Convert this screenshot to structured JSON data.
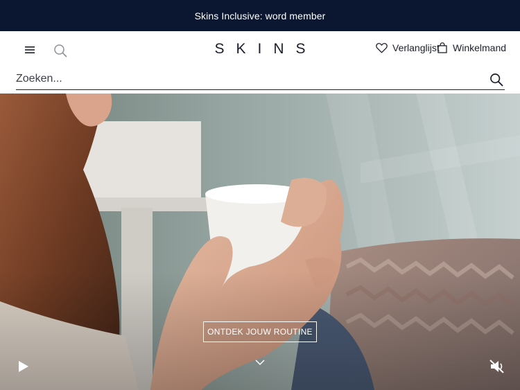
{
  "promo": {
    "text": "Skins Inclusive: word member"
  },
  "header": {
    "logo": "SKINS",
    "wishlist_label": "Verlanglijst",
    "cart_label": "Winkelmand"
  },
  "search": {
    "placeholder": "Zoeken..."
  },
  "hero": {
    "cta_label": "ONTDEK JOUW ROUTINE"
  },
  "colors": {
    "promo_bg": "#0b1730",
    "text": "#1a1f2b",
    "cta_border": "#ffffff"
  },
  "icons": [
    "menu-icon",
    "search-icon",
    "heart-icon",
    "bag-icon",
    "chevron-down-icon",
    "play-icon",
    "mute-icon"
  ]
}
